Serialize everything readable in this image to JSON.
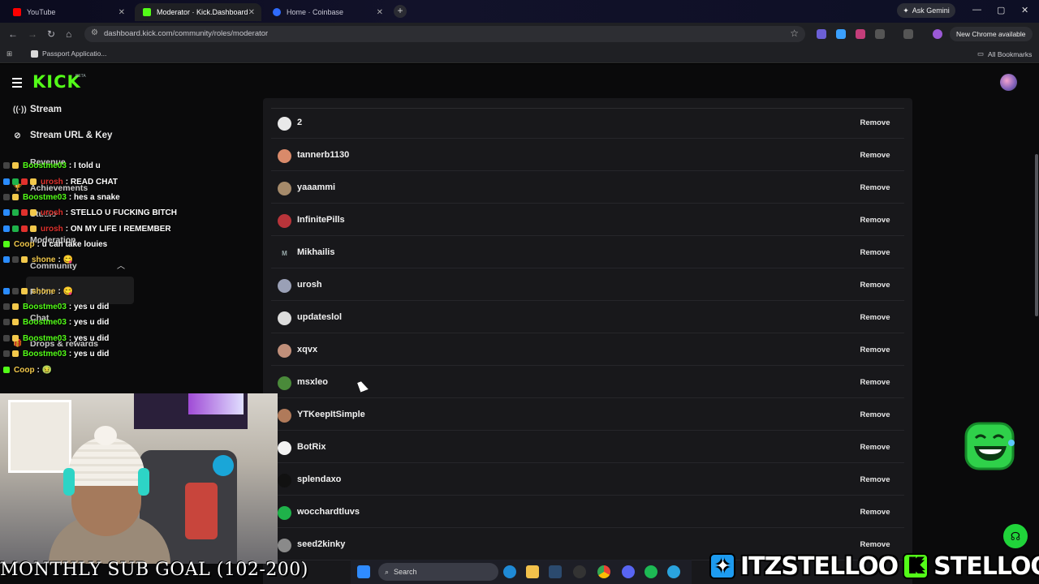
{
  "browser": {
    "tabs": [
      {
        "title": "YouTube",
        "color": "#ff0000",
        "active": false
      },
      {
        "title": "Moderator · Kick.Dashboard",
        "color": "#53fc18",
        "active": true
      },
      {
        "title": "Home · Coinbase",
        "color": "#2f6bff",
        "active": false
      }
    ],
    "ask_gemini": "Ask Gemini",
    "url": "dashboard.kick.com/community/roles/moderator",
    "new_chrome": "New Chrome available",
    "bookmark": "Passport Applicatio...",
    "all_bookmarks": "All Bookmarks"
  },
  "kick": {
    "logo": "KICK",
    "beta": "BETA",
    "accent": "#53fc18",
    "sidebar": [
      {
        "label": "Stream",
        "icon": "broadcast-icon"
      },
      {
        "label": "Stream URL & Key",
        "icon": "link-icon"
      }
    ],
    "sidebar_ghost": [
      "Revenue",
      "Achievements",
      "Studio",
      "Moderation",
      "Community",
      "Roles",
      "Chat",
      "Drops & rewards"
    ]
  },
  "chat": [
    {
      "user": "Boostme03",
      "color": "#53fc18",
      "msg": ": I told u"
    },
    {
      "user": "urosh",
      "color": "#e0312d",
      "msg": ": READ CHAT"
    },
    {
      "user": "Boostme03",
      "color": "#53fc18",
      "msg": ": hes a snake"
    },
    {
      "user": "urosh",
      "color": "#e0312d",
      "msg": ": STELLO U FUCKING BITCH"
    },
    {
      "user": "urosh",
      "color": "#e0312d",
      "msg": ": ON MY LIFE I REMEMBER"
    },
    {
      "user": "Coop",
      "color": "#f2c84b",
      "msg": ": u can take louies"
    },
    {
      "user": "shone",
      "color": "#f2c84b",
      "msg": ": 😋"
    },
    {
      "user": "shone",
      "color": "#f2c84b",
      "msg": ": 😋"
    },
    {
      "user": "Boostme03",
      "color": "#53fc18",
      "msg": ": yes u did"
    },
    {
      "user": "Boostme03",
      "color": "#53fc18",
      "msg": ": yes u did"
    },
    {
      "user": "Boostme03",
      "color": "#53fc18",
      "msg": ": yes u did"
    },
    {
      "user": "Boostme03",
      "color": "#53fc18",
      "msg": ": yes u did"
    },
    {
      "user": "Coop",
      "color": "#f2c84b",
      "msg": ": 🤢"
    }
  ],
  "moderators": {
    "remove_label": "Remove",
    "rows": [
      {
        "name": "2",
        "avatar_color": "#e9e9e9"
      },
      {
        "name": "tannerb1130",
        "avatar_color": "#d98a6a"
      },
      {
        "name": "yaaammi",
        "avatar_color": "#a58a6a"
      },
      {
        "name": "InfinitePills",
        "avatar_color": "#b8343a"
      },
      {
        "name": "Mikhailis",
        "avatar_color": "#18181b",
        "glyph": "M"
      },
      {
        "name": "urosh",
        "avatar_color": "#9aa0b6"
      },
      {
        "name": "updateslol",
        "avatar_color": "#dcdcdc"
      },
      {
        "name": "xqvx",
        "avatar_color": "#c08f7a"
      },
      {
        "name": "msxleo",
        "avatar_color": "#4a8a3a"
      },
      {
        "name": "YTKeepItSimple",
        "avatar_color": "#b07a5a"
      },
      {
        "name": "BotRix",
        "avatar_color": "#f2f2f2"
      },
      {
        "name": "splendaxo",
        "avatar_color": "#111111"
      },
      {
        "name": "wocchardtluvs",
        "avatar_color": "#1fb24a"
      },
      {
        "name": "seed2kinky",
        "avatar_color": "#8a8a8a"
      }
    ]
  },
  "overlay": {
    "sub_goal": "MONTHLY SUB GOAL (102-200)",
    "twitter_handle": "ITZSTELLOO",
    "kick_handle": "STELLOOO",
    "twitter_color": "#1d9bf0",
    "kick_color": "#53fc18"
  },
  "taskbar": {
    "search": "Search"
  }
}
